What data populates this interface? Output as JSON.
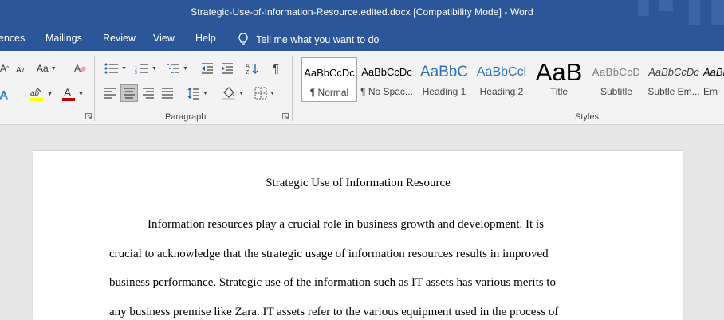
{
  "window": {
    "title": "Strategic-Use-of-Information-Resource.edited.docx [Compatibility Mode]  -  Word"
  },
  "tabs": [
    "ences",
    "Mailings",
    "Review",
    "View",
    "Help"
  ],
  "tell_me": "Tell me what you want to do",
  "ribbon": {
    "font_group": {
      "grow_label": "A",
      "shrink_label": "A",
      "case_label": "Aa"
    },
    "paragraph_label": "Paragraph",
    "styles_label": "Styles",
    "styles": [
      {
        "preview": "AaBbCcDc",
        "name": "¶ Normal"
      },
      {
        "preview": "AaBbCcDc",
        "name": "¶ No Spac..."
      },
      {
        "preview": "AaBbC",
        "name": "Heading 1"
      },
      {
        "preview": "AaBbCcl",
        "name": "Heading 2"
      },
      {
        "preview": "AaB",
        "name": "Title"
      },
      {
        "preview": "AaBbCcD",
        "name": "Subtitle"
      },
      {
        "preview": "AaBbCcDc",
        "name": "Subtle Em..."
      },
      {
        "preview": "AaBbCcDc",
        "name": "Em"
      }
    ],
    "colors": {
      "highlight": "#ffff00",
      "font_color": "#c00000"
    }
  },
  "document": {
    "title": "Strategic Use of Information Resource",
    "lines": [
      "Information resources play a crucial role in business growth and development. It is",
      "crucial to acknowledge that the strategic usage of information resources results in improved",
      "business performance. Strategic use of the information such as IT assets has various merits to",
      "any business premise like Zara. IT assets refer to the various equipment used in the process of"
    ]
  },
  "colors": {
    "titlebar": "#2b579a",
    "ribbon": "#f3f3f3",
    "canvas": "#e6e6e6"
  }
}
